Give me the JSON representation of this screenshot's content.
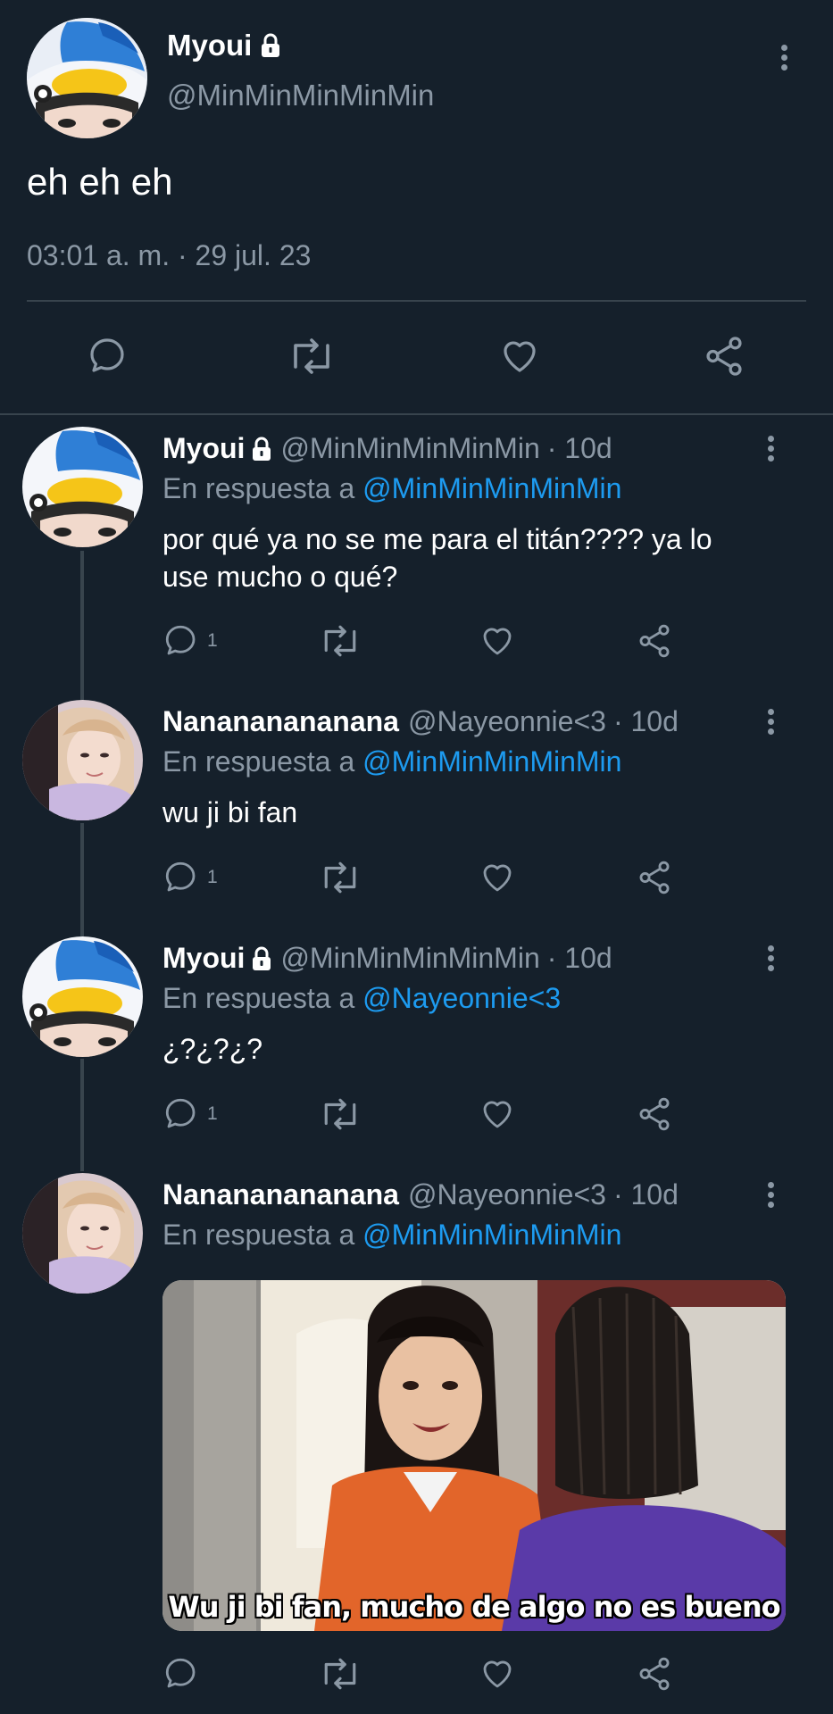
{
  "main_tweet": {
    "display_name": "Myoui",
    "handle": "@MinMinMinMinMin",
    "text": "eh eh eh",
    "timestamp": "03:01 a. m. · 29 jul. 23"
  },
  "replies": [
    {
      "display_name": "Myoui",
      "handle": "@MinMinMinMinMin",
      "age": "· 10d",
      "reply_prefix": "En respuesta a",
      "reply_to": "@MinMinMinMinMin",
      "text_line1": "por qué ya no se me para el titán???? ya lo",
      "text_line2": "use mucho o qué?",
      "reply_count": "1"
    },
    {
      "display_name": "Nanananananana",
      "handle": "@Nayeonnie<3",
      "age": "· 10d",
      "reply_prefix": "En respuesta a",
      "reply_to": "@MinMinMinMinMin",
      "text": "wu ji bi fan",
      "reply_count": "1"
    },
    {
      "display_name": "Myoui",
      "handle": "@MinMinMinMinMin",
      "age": "· 10d",
      "reply_prefix": "En respuesta a",
      "reply_to": "@Nayeonnie<3",
      "text": "¿?¿?¿?",
      "reply_count": "1"
    },
    {
      "display_name": "Nanananananana",
      "handle": "@Nayeonnie<3",
      "age": "· 10d",
      "reply_prefix": "En respuesta a",
      "reply_to": "@MinMinMinMinMin",
      "media_caption": "Wu ji bi fan, mucho de algo no es bueno"
    }
  ],
  "colors": {
    "background": "#15202b",
    "text": "#ffffff",
    "secondary": "#8b98a5",
    "link": "#1d9bf0",
    "divider": "#38444d"
  },
  "icons": [
    "lock-icon",
    "more-options-icon",
    "reply-icon",
    "retweet-icon",
    "like-icon",
    "share-icon"
  ]
}
